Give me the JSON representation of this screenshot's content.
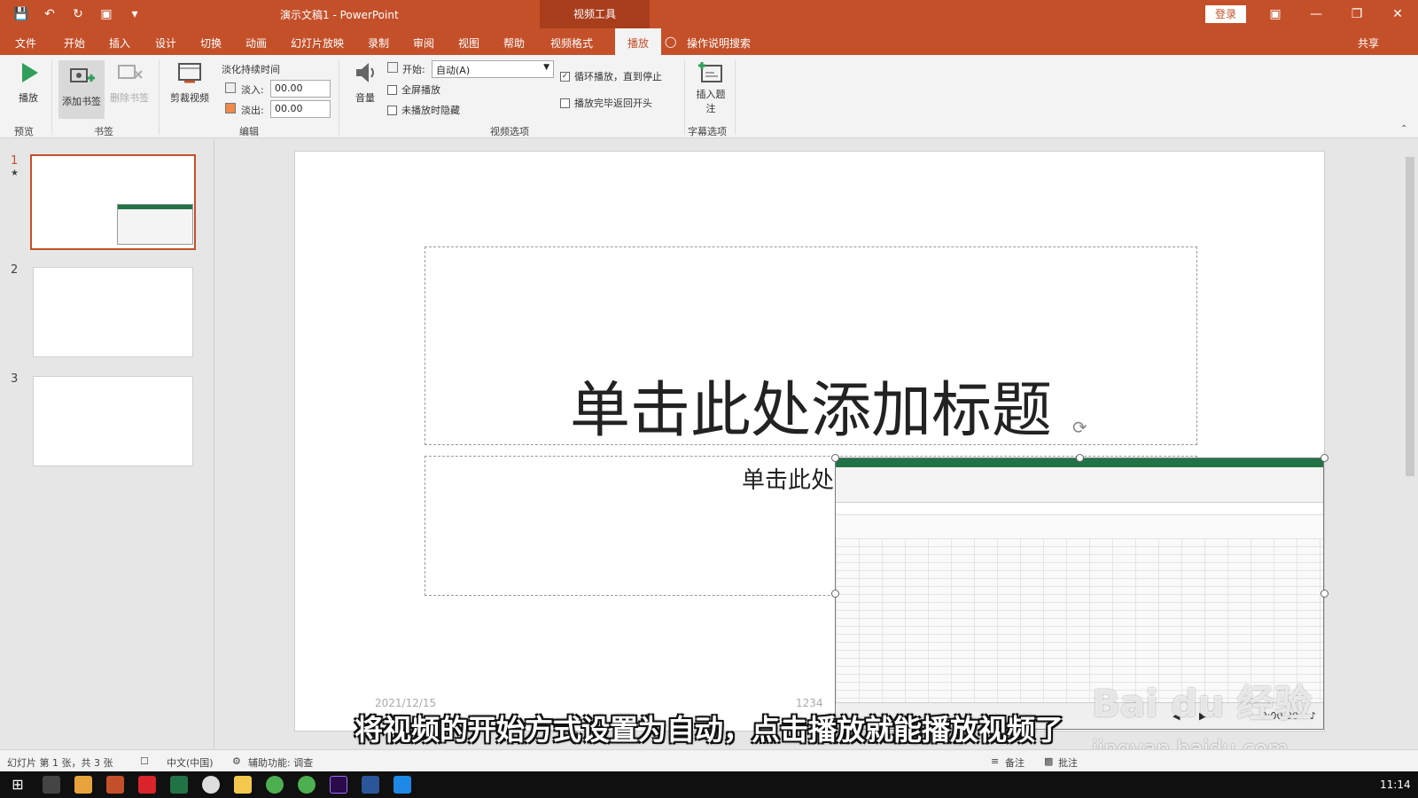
{
  "titlebar": {
    "doc_title": "演示文稿1  -  PowerPoint",
    "context_group": "视频工具",
    "login": "登录"
  },
  "tabs": [
    "文件",
    "开始",
    "插入",
    "设计",
    "切换",
    "动画",
    "幻灯片放映",
    "录制",
    "审阅",
    "视图",
    "帮助",
    "视频格式",
    "播放"
  ],
  "active_tab": "播放",
  "search": "操作说明搜索",
  "share": "共享",
  "ribbon": {
    "play": "播放",
    "add_bookmark": "添加书签",
    "remove_bookmark": "删除书签",
    "trim": "剪裁视频",
    "fade_duration": "淡化持续时间",
    "fade_in_label": "淡入:",
    "fade_in_value": "00.00",
    "fade_out_label": "淡出:",
    "fade_out_value": "00.00",
    "volume": "音量",
    "start_label": "开始:",
    "start_value": "自动(A)",
    "fullscreen": "全屏播放",
    "hide_not_playing": "未播放时隐藏",
    "loop": "循环播放，直到停止",
    "rewind": "播放完毕返回开头",
    "insert_caption_1": "插入题",
    "insert_caption_2": "注",
    "groups": {
      "preview": "预览",
      "bookmarks": "书签",
      "editing": "编辑",
      "video_options": "视频选项",
      "caption_options": "字幕选项"
    }
  },
  "thumbnails": [
    {
      "num": "1",
      "star": "★"
    },
    {
      "num": "2"
    },
    {
      "num": "3"
    }
  ],
  "slide": {
    "title": "单击此处添加标题",
    "subtitle": "单击此处添加",
    "date": "2021/12/15",
    "number": "1234"
  },
  "video": {
    "time": "0:00.00"
  },
  "caption": "将视频的开始方式设置为自动，点击播放就能播放视频了",
  "watermark": {
    "brand": "Bai du 经验",
    "url": "jingyan.baidu.com"
  },
  "statusbar": {
    "slide_info": "幻灯片 第 1 张，共 3 张",
    "language": "中文(中国)",
    "accessibility": "辅助功能: 调查",
    "notes": "备注",
    "comments": "批注"
  },
  "taskbar": {
    "time": "11:14"
  },
  "colors": {
    "accent": "#c4502a",
    "ribbon_bg": "#f3f3f3"
  }
}
